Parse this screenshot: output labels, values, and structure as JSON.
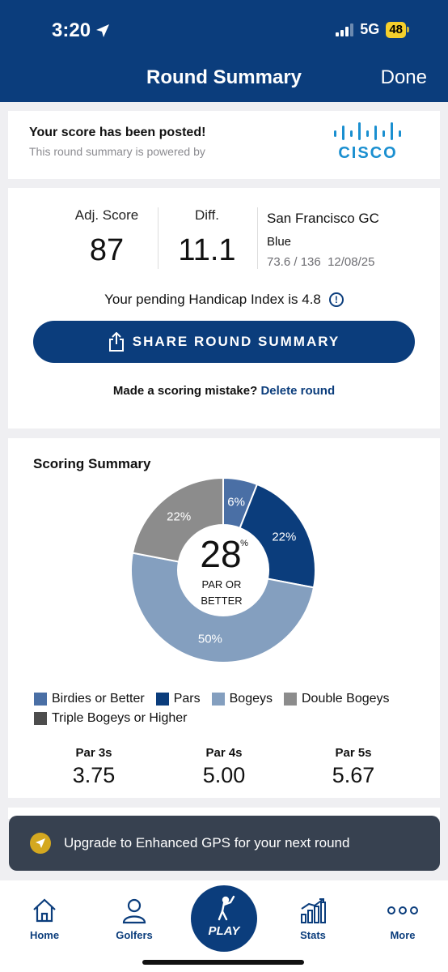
{
  "status_bar": {
    "time": "3:20",
    "network": "5G",
    "battery": "48"
  },
  "header": {
    "title": "Round Summary",
    "done_label": "Done"
  },
  "posted": {
    "title": "Your score has been posted!",
    "subtitle": "This round summary is powered by",
    "sponsor": "CISCO"
  },
  "score": {
    "adj_label": "Adj. Score",
    "adj_value": "87",
    "diff_label": "Diff.",
    "diff_value": "11.1",
    "course_name": "San Francisco GC",
    "tee": "Blue",
    "rating_slope": "73.6 / 136",
    "date": "12/08/25",
    "pending_text": "Your pending Handicap Index is 4.8",
    "share_label": "SHARE ROUND SUMMARY",
    "mistake_text": "Made a scoring mistake?",
    "delete_label": "Delete round"
  },
  "scoring_summary": {
    "title": "Scoring Summary",
    "center_value": "28",
    "center_unit": "%",
    "center_caption_1": "PAR OR",
    "center_caption_2": "BETTER",
    "legend": [
      {
        "label": "Birdies or Better",
        "color": "#4a6fa5"
      },
      {
        "label": "Pars",
        "color": "#0b3d7c"
      },
      {
        "label": "Bogeys",
        "color": "#849fbf"
      },
      {
        "label": "Double Bogeys",
        "color": "#8c8c8c"
      },
      {
        "label": "Triple Bogeys or Higher",
        "color": "#4d4d4d"
      }
    ],
    "par_stats": [
      {
        "label": "Par 3s",
        "value": "3.75"
      },
      {
        "label": "Par 4s",
        "value": "5.00"
      },
      {
        "label": "Par 5s",
        "value": "5.67"
      }
    ]
  },
  "chart_data": {
    "type": "pie",
    "labels": [
      "Birdies or Better",
      "Pars",
      "Bogeys",
      "Double Bogeys"
    ],
    "values": [
      6,
      22,
      50,
      22
    ],
    "value_labels": [
      "6%",
      "22%",
      "50%",
      "22%"
    ],
    "colors": [
      "#4a6fa5",
      "#0b3d7c",
      "#849fbf",
      "#8c8c8c"
    ]
  },
  "upgrade_banner": {
    "text": "Upgrade to Enhanced GPS for your next round"
  },
  "tabbar": {
    "home": "Home",
    "golfers": "Golfers",
    "play": "PLAY",
    "stats": "Stats",
    "more": "More"
  }
}
